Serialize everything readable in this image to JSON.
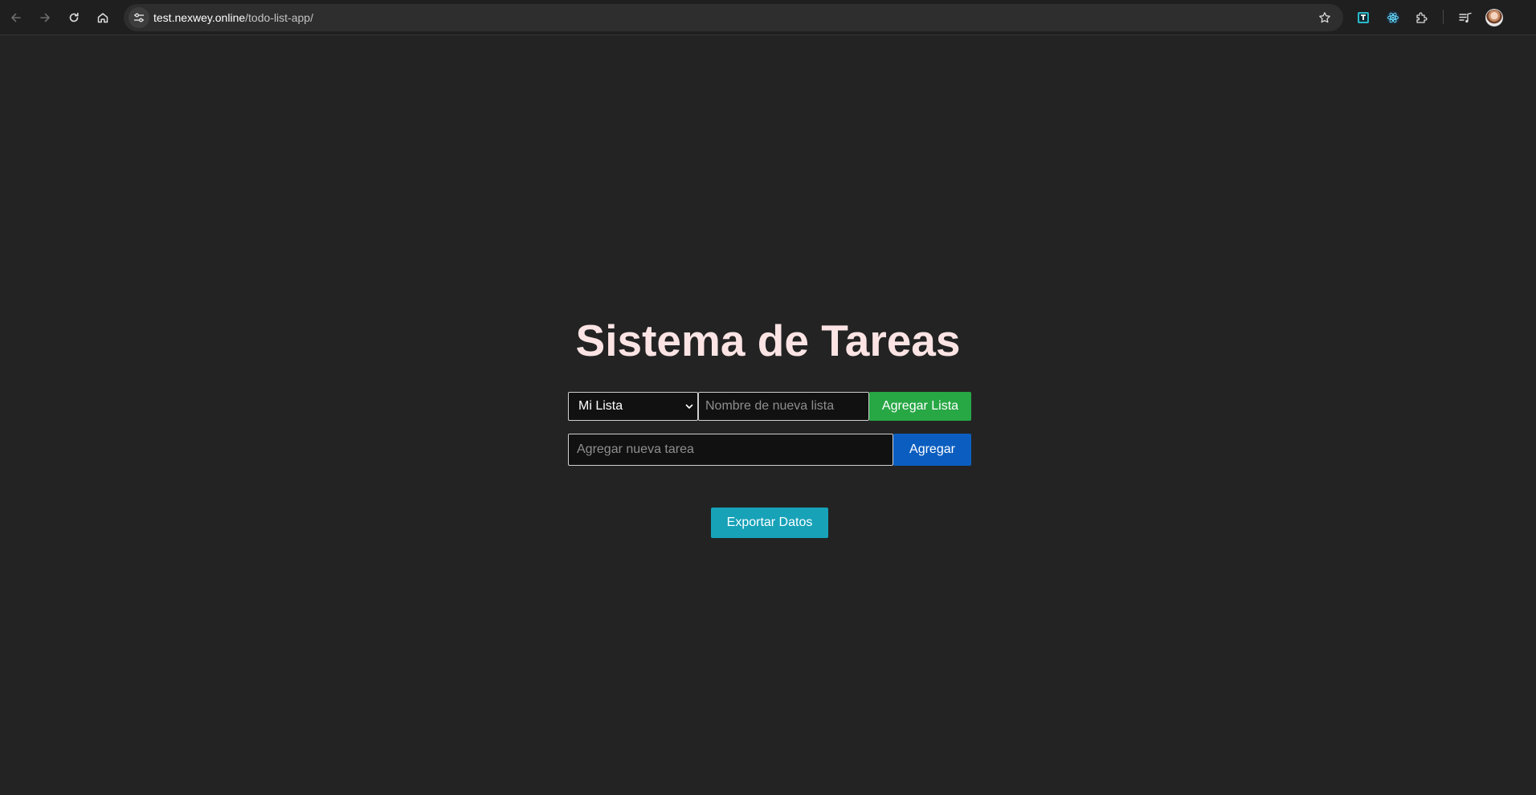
{
  "browser": {
    "url_host": "test.nexwey.online",
    "url_path": "/todo-list-app/"
  },
  "app": {
    "title": "Sistema de Tareas",
    "list_select": {
      "selected": "Mi Lista"
    },
    "new_list_input": {
      "placeholder": "Nombre de nueva lista",
      "value": ""
    },
    "add_list_button": "Agregar Lista",
    "new_task_input": {
      "placeholder": "Agregar nueva tarea",
      "value": ""
    },
    "add_task_button": "Agregar",
    "export_button": "Exportar Datos"
  },
  "colors": {
    "background": "#232323",
    "title": "#fce4e4",
    "add_list_green": "#28a745",
    "add_blue": "#0b5ec0",
    "export_teal": "#17a2b8"
  }
}
